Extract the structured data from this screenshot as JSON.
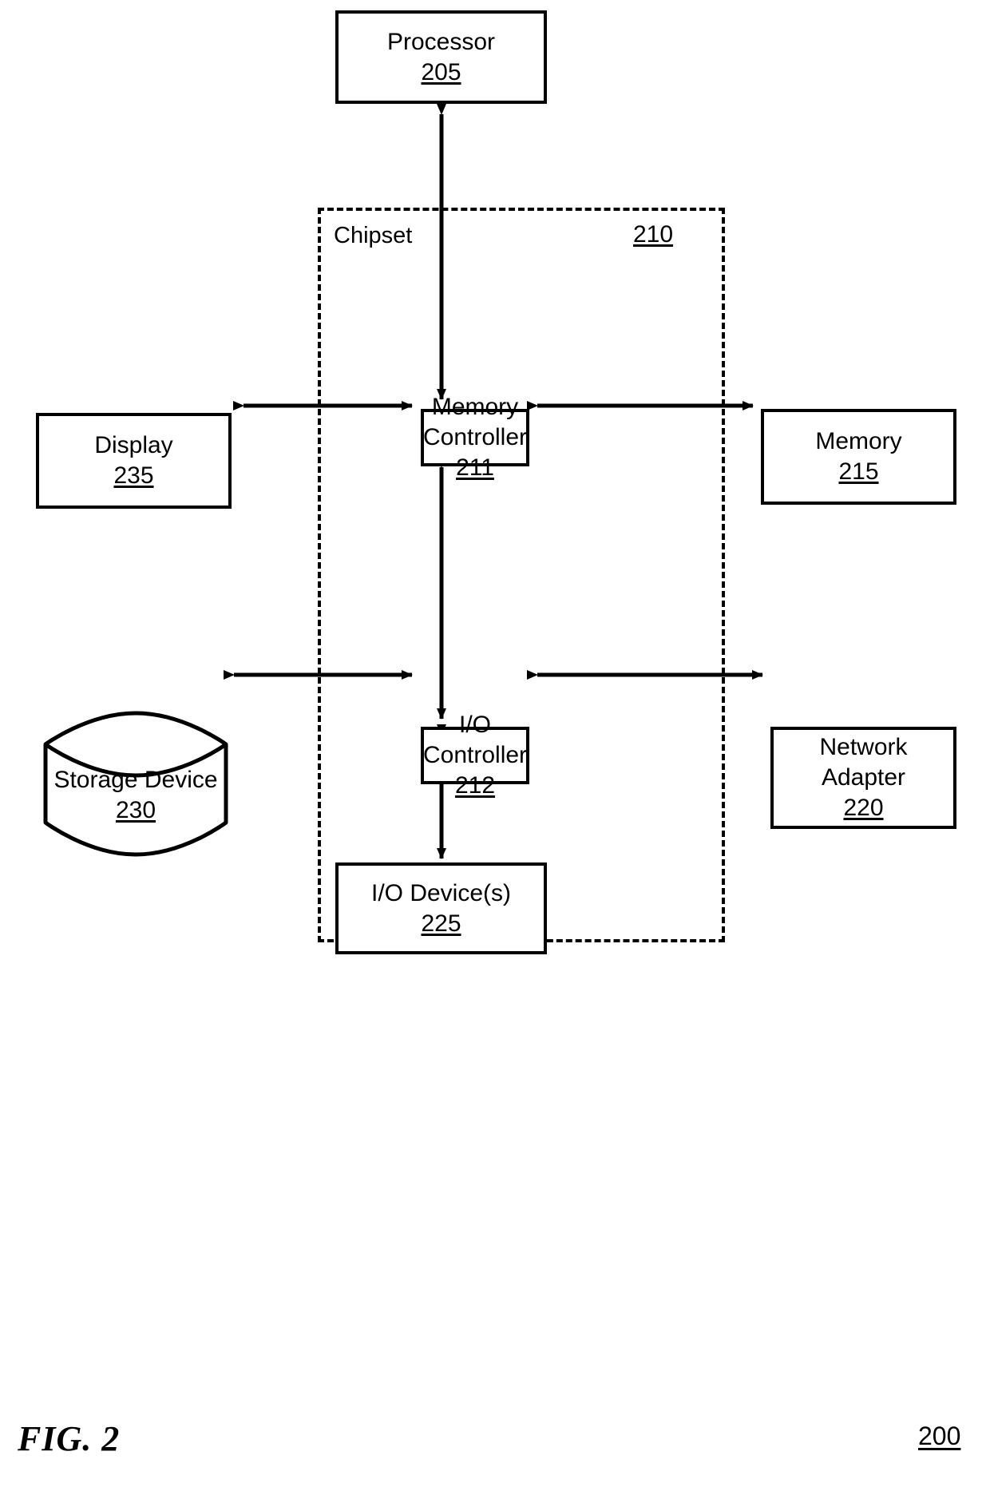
{
  "figure": {
    "caption": "FIG. 2",
    "system_number": "200"
  },
  "chipset": {
    "label": "Chipset",
    "number": "210"
  },
  "blocks": {
    "processor": {
      "title": "Processor",
      "number": "205"
    },
    "memory_controller": {
      "title": "Memory\nController",
      "number": "211"
    },
    "io_controller": {
      "title": "I/O Controller",
      "number": "212"
    },
    "display": {
      "title": "Display",
      "number": "235"
    },
    "memory": {
      "title": "Memory",
      "number": "215"
    },
    "storage_device": {
      "title": "Storage Device",
      "number": "230"
    },
    "network_adapter": {
      "title": "Network\nAdapter",
      "number": "220"
    },
    "io_devices": {
      "title": "I/O Device(s)",
      "number": "225"
    }
  },
  "connections": [
    {
      "name": "processor-to-memory-controller",
      "from": "processor",
      "to": "memory_controller",
      "arrow": "double-vertical"
    },
    {
      "name": "display-to-memory-controller",
      "from": "display",
      "to": "memory_controller",
      "arrow": "double-horizontal"
    },
    {
      "name": "memory-controller-to-memory",
      "from": "memory_controller",
      "to": "memory",
      "arrow": "double-horizontal"
    },
    {
      "name": "memory-controller-to-io-controller",
      "from": "memory_controller",
      "to": "io_controller",
      "arrow": "double-vertical"
    },
    {
      "name": "storage-device-to-io-controller",
      "from": "storage_device",
      "to": "io_controller",
      "arrow": "double-horizontal"
    },
    {
      "name": "io-controller-to-network-adapter",
      "from": "io_controller",
      "to": "network_adapter",
      "arrow": "double-horizontal"
    },
    {
      "name": "io-controller-to-io-devices",
      "from": "io_controller",
      "to": "io_devices",
      "arrow": "double-vertical"
    }
  ],
  "colors": {
    "stroke": "#000000",
    "background": "#ffffff"
  }
}
